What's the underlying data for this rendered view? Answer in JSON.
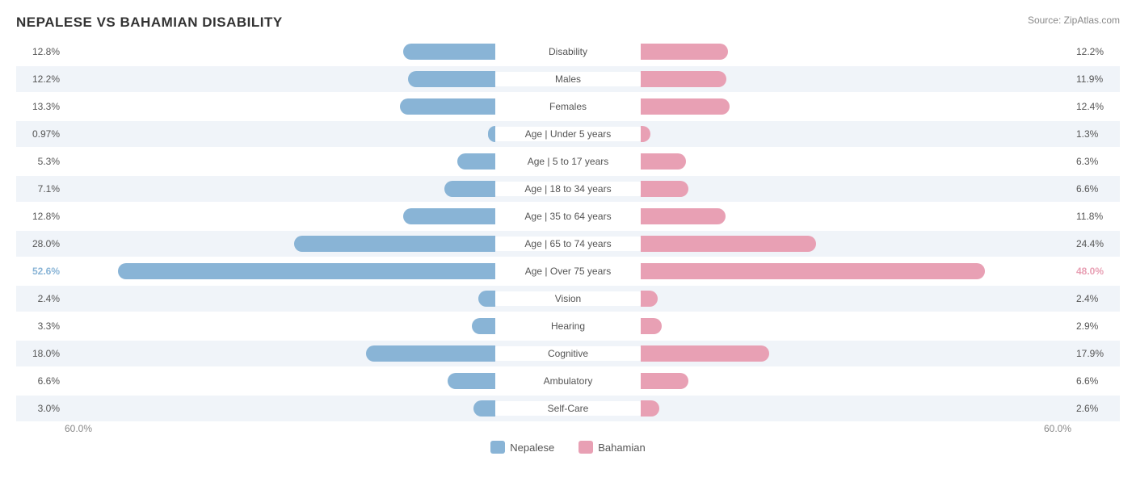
{
  "title": "NEPALESE VS BAHAMIAN DISABILITY",
  "source": "Source: ZipAtlas.com",
  "colors": {
    "blue": "#89b4d6",
    "pink": "#e8a0b4"
  },
  "legend": {
    "left_label": "Nepalese",
    "right_label": "Bahamian"
  },
  "axis": {
    "left": "60.0%",
    "right": "60.0%"
  },
  "max_scale": 60,
  "rows": [
    {
      "label": "Disability",
      "left_val": 12.8,
      "left_text": "12.8%",
      "right_val": 12.2,
      "right_text": "12.2%"
    },
    {
      "label": "Males",
      "left_val": 12.2,
      "left_text": "12.2%",
      "right_val": 11.9,
      "right_text": "11.9%"
    },
    {
      "label": "Females",
      "left_val": 13.3,
      "left_text": "13.3%",
      "right_val": 12.4,
      "right_text": "12.4%"
    },
    {
      "label": "Age | Under 5 years",
      "left_val": 0.97,
      "left_text": "0.97%",
      "right_val": 1.3,
      "right_text": "1.3%"
    },
    {
      "label": "Age | 5 to 17 years",
      "left_val": 5.3,
      "left_text": "5.3%",
      "right_val": 6.3,
      "right_text": "6.3%"
    },
    {
      "label": "Age | 18 to 34 years",
      "left_val": 7.1,
      "left_text": "7.1%",
      "right_val": 6.6,
      "right_text": "6.6%"
    },
    {
      "label": "Age | 35 to 64 years",
      "left_val": 12.8,
      "left_text": "12.8%",
      "right_val": 11.8,
      "right_text": "11.8%"
    },
    {
      "label": "Age | 65 to 74 years",
      "left_val": 28.0,
      "left_text": "28.0%",
      "right_val": 24.4,
      "right_text": "24.4%"
    },
    {
      "label": "Age | Over 75 years",
      "left_val": 52.6,
      "left_text": "52.6%",
      "right_val": 48.0,
      "right_text": "48.0%"
    },
    {
      "label": "Vision",
      "left_val": 2.4,
      "left_text": "2.4%",
      "right_val": 2.4,
      "right_text": "2.4%"
    },
    {
      "label": "Hearing",
      "left_val": 3.3,
      "left_text": "3.3%",
      "right_val": 2.9,
      "right_text": "2.9%"
    },
    {
      "label": "Cognitive",
      "left_val": 18.0,
      "left_text": "18.0%",
      "right_val": 17.9,
      "right_text": "17.9%"
    },
    {
      "label": "Ambulatory",
      "left_val": 6.6,
      "left_text": "6.6%",
      "right_val": 6.6,
      "right_text": "6.6%"
    },
    {
      "label": "Self-Care",
      "left_val": 3.0,
      "left_text": "3.0%",
      "right_val": 2.6,
      "right_text": "2.6%"
    }
  ]
}
